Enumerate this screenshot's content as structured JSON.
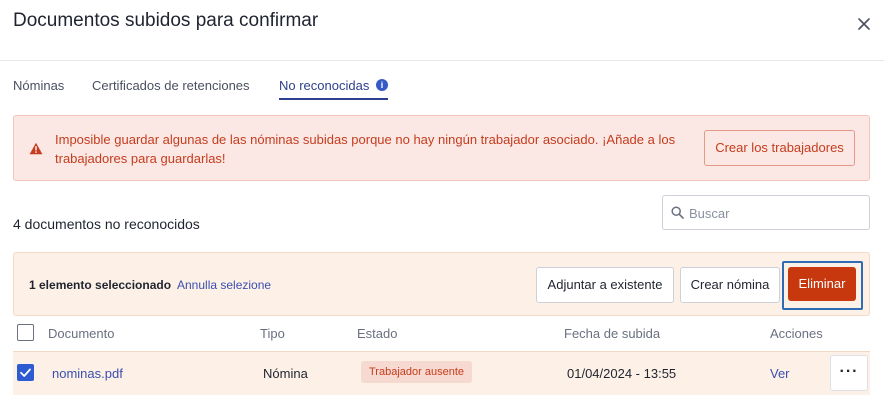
{
  "dialog": {
    "title": "Documentos subidos para confirmar"
  },
  "tabs": [
    {
      "label": "Nóminas"
    },
    {
      "label": "Certificados de retenciones"
    },
    {
      "label": "No reconocidas",
      "active": true
    }
  ],
  "alert": {
    "message": "Imposible guardar algunas de las nóminas subidas porque no hay ningún trabajador asociado. ¡Añade a los trabajadores para guardarlas!",
    "action_label": "Crear los trabajadores",
    "icon": "warning-icon"
  },
  "list": {
    "count_label": "4 documentos no reconocidos",
    "search_placeholder": "Buscar"
  },
  "selection": {
    "selected_label": "1 elemento seleccionado",
    "clear_label": "Annulla selezione",
    "attach_label": "Adjuntar a existente",
    "create_label": "Crear nómina",
    "delete_label": "Eliminar"
  },
  "table": {
    "columns": [
      "Documento",
      "Tipo",
      "Estado",
      "Fecha de subida",
      "Acciones"
    ],
    "rows": [
      {
        "document": "nominas.pdf",
        "type": "Nómina",
        "status": "Trabajador ausente",
        "uploaded": "01/04/2024 - 13:55",
        "action": "Ver",
        "selected": true
      }
    ]
  },
  "colors": {
    "accent": "#2f3f8f",
    "danger": "#c8380e",
    "alert_bg": "#fbe8e4",
    "selection_bg": "#fdf0e6"
  }
}
